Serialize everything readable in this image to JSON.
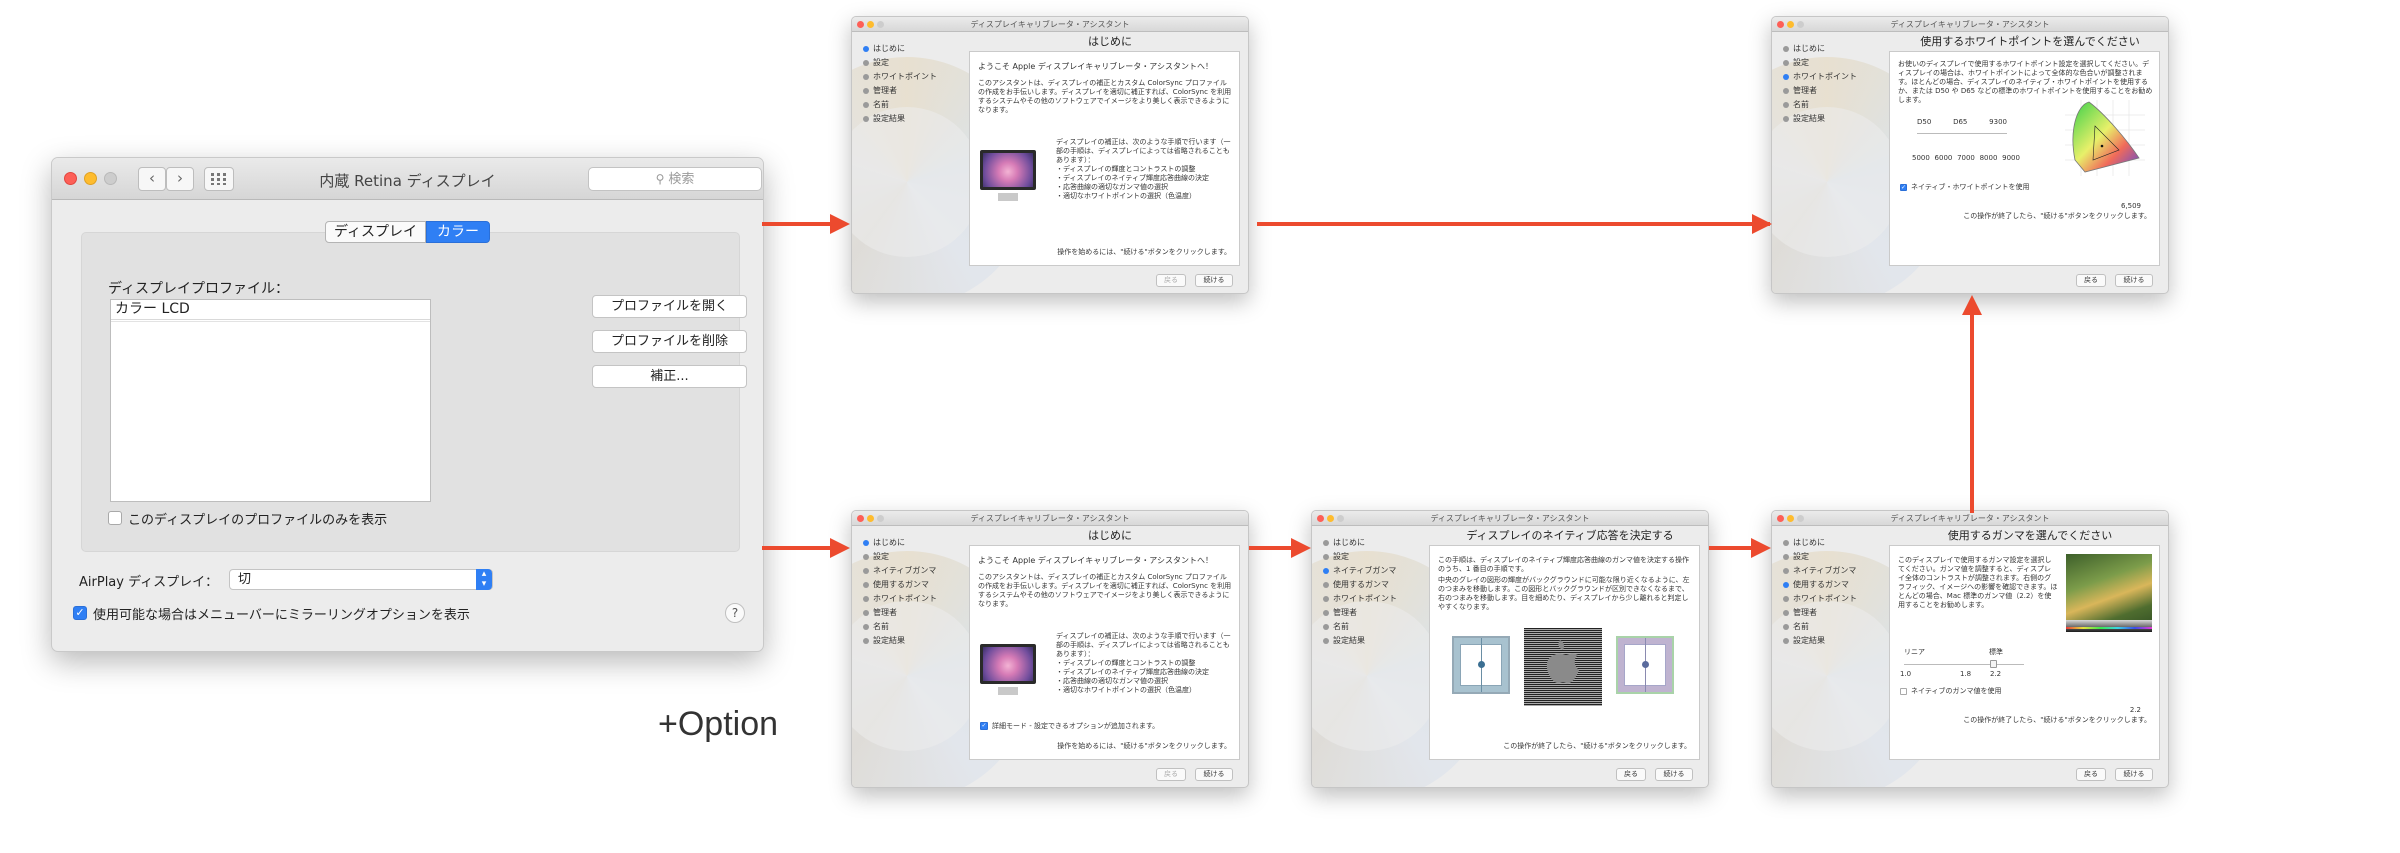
{
  "main_window": {
    "title": "内蔵 Retina ディスプレイ",
    "search_placeholder": "検索",
    "tabs": [
      "ディスプレイ",
      "カラー"
    ],
    "selected_tab": "カラー",
    "profile_label": "ディスプレイプロファイル：",
    "profiles": [
      "カラー LCD"
    ],
    "buttons": {
      "open": "プロファイルを開く",
      "delete": "プロファイルを削除",
      "calibrate": "補正..."
    },
    "only_this_display": "このディスプレイのプロファイルのみを表示",
    "airplay_label": "AirPlay ディスプレイ：",
    "airplay_value": "切",
    "mirroring_option": "使用可能な場合はメニューバーにミラーリングオプションを表示",
    "help": "?"
  },
  "annotation": "+Option",
  "assistant_title": "ディスプレイキャリブレータ・アシスタント",
  "buttons": {
    "back": "戻る",
    "continue": "続ける"
  },
  "steps_basic": [
    "はじめに",
    "設定",
    "ホワイトポイント",
    "管理者",
    "名前",
    "設定結果"
  ],
  "steps_expert": [
    "はじめに",
    "設定",
    "ネイティブガンマ",
    "使用するガンマ",
    "ホワイトポイント",
    "管理者",
    "名前",
    "設定結果"
  ],
  "intro": {
    "heading": "はじめに",
    "welcome": "ようこそ Apple ディスプレイキャリブレータ・アシスタントへ！",
    "p1": "このアシスタントは、ディスプレイの補正とカスタム ColorSync プロファイルの作成をお手伝いします。ディスプレイを適切に補正すれば、ColorSync を利用するシステムやその他のソフトウェアでイメージをより美しく表示できるようになります。",
    "p2": "ディスプレイの補正は、次のような手順で行います（一部の手順は、ディスプレイによっては省略されることもあります）：",
    "list": [
      "・ディスプレイの輝度とコントラストの調整",
      "・ディスプレイのネイティブ輝度応答曲線の決定",
      "・応答曲線の適切なガンマ値の選択",
      "・適切なホワイトポイントの選択（色温度）"
    ],
    "footer": "操作を始めるには、\"続ける\"ボタンをクリックします。",
    "expert_mode": "詳細モード - 設定できるオプションが追加されます。"
  },
  "white_point": {
    "heading": "使用するホワイトポイントを選んでください",
    "desc": "お使いのディスプレイで使用するホワイトポイント設定を選択してください。ディスプレイの場合は、ホワイトポイントによって全体的な色合いが調整されます。ほとんどの場合、ディスプレイのネイティブ・ホワイトポイントを使用するか、または D50 や D65 などの標準のホワイトポイントを使用することをお勧めします。",
    "marks": [
      "D50",
      "D65",
      "9300"
    ],
    "scale": [
      "5000",
      "6000",
      "7000",
      "8000",
      "9000"
    ],
    "native_label": "ネイティブ・ホワイトポイントを使用",
    "value": "6,509",
    "footer": "この操作が終了したら、\"続ける\"ボタンをクリックします。"
  },
  "native_response": {
    "heading": "ディスプレイのネイティブ応答を決定する",
    "desc": "この手順は、ディスプレイのネイティブ輝度応答曲線のガンマ値を決定する操作のうち、1 番目の手順です。",
    "desc2": "中央のグレイの図形の輝度がバックグラウンドに可能な限り近くなるように、左のつまみを移動します。この図形とバックグラウンドが区別できなくなるまで、右のつまみを移動します。目を細めたり、ディスプレイから少し離れると判定しやすくなります。",
    "footer": "この操作が終了したら、\"続ける\"ボタンをクリックします。"
  },
  "gamma": {
    "heading": "使用するガンマを選んでください",
    "desc": "このディスプレイで使用するガンマ設定を選択してください。ガンマ値を調整すると、ディスプレイ全体のコントラストが調整されます。右側のグラフィック、イメージへの影響を確認できます。ほとんどの場合、Mac 標準のガンマ値（2.2）を使用することをお勧めします。",
    "scale_labels": [
      "リニア",
      "標準"
    ],
    "ticks": [
      "1.0",
      "1.8",
      "2.2"
    ],
    "native_label": "ネイティブのガンマ値を使用",
    "value": "2.2",
    "footer": "この操作が終了したら、\"続ける\"ボタンをクリックします。"
  },
  "colors": {
    "arrow": "#ec4a2e",
    "accent": "#2f7ff4"
  }
}
